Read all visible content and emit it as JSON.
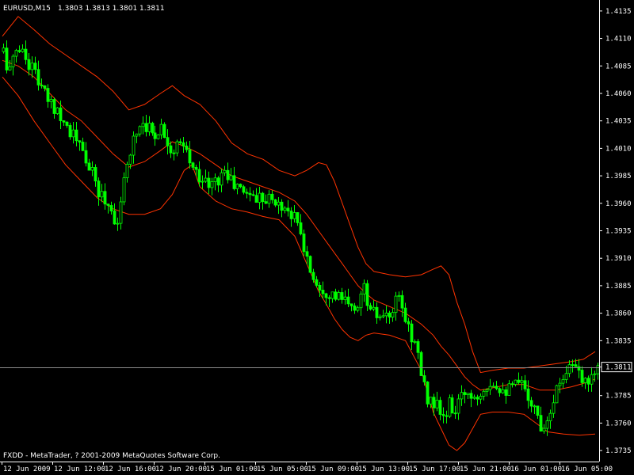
{
  "header": {
    "symbol": "EURUSD,M15",
    "ohlc": "1.3803 1.3813 1.3801 1.3811"
  },
  "footer": {
    "copyright": "FXDD - MetaTrader, ? 2001-2009 MetaQuotes Software Corp."
  },
  "colors": {
    "background": "#000000",
    "candle": "#00ff00",
    "bands": "#ff3300",
    "grid": "#ffffff",
    "priceLine": "#8c8c8c",
    "text": "#ffffff"
  },
  "chart_data": {
    "type": "candlestick",
    "title": "EURUSD,M15",
    "ylim": [
      1.3725,
      1.4145
    ],
    "y_ticks": [
      "1.4135",
      "1.4110",
      "1.4085",
      "1.4060",
      "1.4035",
      "1.4010",
      "1.3985",
      "1.3960",
      "1.3935",
      "1.3910",
      "1.3885",
      "1.3860",
      "1.3835",
      "1.3811",
      "1.3785",
      "1.3760",
      "1.3735"
    ],
    "x_ticks": [
      "12 Jun 2009",
      "12 Jun 12:00",
      "12 Jun 16:00",
      "12 Jun 20:00",
      "15 Jun 01:00",
      "15 Jun 05:00",
      "15 Jun 09:00",
      "15 Jun 13:00",
      "15 Jun 17:00",
      "15 Jun 21:00",
      "16 Jun 01:00",
      "16 Jun 05:00"
    ],
    "current_price": "1.3811",
    "trend": [
      [
        0,
        1.4098
      ],
      [
        5,
        1.4085
      ],
      [
        10,
        1.408
      ],
      [
        15,
        1.41
      ],
      [
        20,
        1.4102
      ],
      [
        30,
        1.409
      ],
      [
        40,
        1.408
      ],
      [
        50,
        1.406
      ],
      [
        60,
        1.405
      ],
      [
        70,
        1.4045
      ],
      [
        80,
        1.403
      ],
      [
        90,
        1.402
      ],
      [
        100,
        1.4005
      ],
      [
        110,
        1.399
      ],
      [
        120,
        1.397
      ],
      [
        130,
        1.3962
      ],
      [
        140,
        1.3948
      ],
      [
        145,
        1.3942
      ],
      [
        150,
        1.3965
      ],
      [
        155,
        1.3995
      ],
      [
        160,
        1.401
      ],
      [
        165,
        1.402
      ],
      [
        170,
        1.403
      ],
      [
        175,
        1.4035
      ],
      [
        180,
        1.4032
      ],
      [
        190,
        1.4022
      ],
      [
        200,
        1.403
      ],
      [
        210,
        1.4015
      ],
      [
        215,
        1.4005
      ],
      [
        220,
        1.4012
      ],
      [
        225,
        1.401
      ],
      [
        230,
        1.401
      ],
      [
        235,
        1.4
      ],
      [
        240,
        1.399
      ],
      [
        250,
        1.3985
      ],
      [
        260,
        1.3975
      ],
      [
        270,
        1.398
      ],
      [
        280,
        1.399
      ],
      [
        290,
        1.3978
      ],
      [
        300,
        1.3972
      ],
      [
        310,
        1.397
      ],
      [
        320,
        1.3965
      ],
      [
        330,
        1.3968
      ],
      [
        340,
        1.3962
      ],
      [
        350,
        1.3958
      ],
      [
        360,
        1.3955
      ],
      [
        370,
        1.3945
      ],
      [
        380,
        1.392
      ],
      [
        390,
        1.3895
      ],
      [
        400,
        1.3885
      ],
      [
        410,
        1.388
      ],
      [
        420,
        1.3875
      ],
      [
        430,
        1.3872
      ],
      [
        440,
        1.3862
      ],
      [
        450,
        1.387
      ],
      [
        455,
        1.3885
      ],
      [
        460,
        1.3872
      ],
      [
        465,
        1.3858
      ],
      [
        470,
        1.386
      ],
      [
        480,
        1.3852
      ],
      [
        490,
        1.3858
      ],
      [
        495,
        1.3868
      ],
      [
        500,
        1.3872
      ],
      [
        505,
        1.3862
      ],
      [
        510,
        1.385
      ],
      [
        515,
        1.3842
      ],
      [
        520,
        1.3832
      ],
      [
        525,
        1.382
      ],
      [
        530,
        1.3795
      ],
      [
        535,
        1.3785
      ],
      [
        540,
        1.378
      ],
      [
        545,
        1.3778
      ],
      [
        550,
        1.3772
      ],
      [
        555,
        1.3765
      ],
      [
        560,
        1.3768
      ],
      [
        565,
        1.3778
      ],
      [
        570,
        1.377
      ],
      [
        575,
        1.3775
      ],
      [
        580,
        1.3782
      ],
      [
        585,
        1.379
      ],
      [
        590,
        1.3788
      ],
      [
        595,
        1.3784
      ],
      [
        600,
        1.3786
      ],
      [
        605,
        1.3792
      ],
      [
        610,
        1.3796
      ],
      [
        620,
        1.3798
      ],
      [
        630,
        1.3793
      ],
      [
        640,
        1.379
      ],
      [
        650,
        1.3795
      ],
      [
        660,
        1.3793
      ],
      [
        665,
        1.3785
      ],
      [
        670,
        1.3775
      ],
      [
        675,
        1.3768
      ],
      [
        680,
        1.3758
      ],
      [
        685,
        1.376
      ],
      [
        690,
        1.377
      ],
      [
        695,
        1.3782
      ],
      [
        700,
        1.379
      ],
      [
        705,
        1.38
      ],
      [
        710,
        1.3808
      ],
      [
        715,
        1.3812
      ],
      [
        720,
        1.3814
      ],
      [
        725,
        1.3805
      ],
      [
        730,
        1.38
      ],
      [
        735,
        1.3795
      ],
      [
        740,
        1.3802
      ],
      [
        745,
        1.3808
      ],
      [
        750,
        1.381
      ],
      [
        752,
        1.3811
      ]
    ],
    "upper_band": [
      [
        0,
        1.4112
      ],
      [
        20,
        1.413
      ],
      [
        40,
        1.4118
      ],
      [
        60,
        1.4105
      ],
      [
        80,
        1.4095
      ],
      [
        100,
        1.4085
      ],
      [
        120,
        1.4075
      ],
      [
        140,
        1.4062
      ],
      [
        160,
        1.4045
      ],
      [
        180,
        1.405
      ],
      [
        200,
        1.406
      ],
      [
        215,
        1.4067
      ],
      [
        230,
        1.4058
      ],
      [
        250,
        1.405
      ],
      [
        270,
        1.4035
      ],
      [
        290,
        1.4015
      ],
      [
        310,
        1.4005
      ],
      [
        330,
        1.4
      ],
      [
        350,
        1.399
      ],
      [
        370,
        1.3985
      ],
      [
        385,
        1.399
      ],
      [
        400,
        1.3997
      ],
      [
        410,
        1.3995
      ],
      [
        420,
        1.398
      ],
      [
        430,
        1.396
      ],
      [
        440,
        1.394
      ],
      [
        450,
        1.392
      ],
      [
        460,
        1.3905
      ],
      [
        470,
        1.3898
      ],
      [
        490,
        1.3895
      ],
      [
        510,
        1.3893
      ],
      [
        530,
        1.3895
      ],
      [
        545,
        1.39
      ],
      [
        555,
        1.3903
      ],
      [
        565,
        1.3895
      ],
      [
        575,
        1.387
      ],
      [
        585,
        1.385
      ],
      [
        595,
        1.3825
      ],
      [
        605,
        1.3806
      ],
      [
        620,
        1.3808
      ],
      [
        640,
        1.381
      ],
      [
        660,
        1.381
      ],
      [
        680,
        1.3812
      ],
      [
        700,
        1.3814
      ],
      [
        720,
        1.3816
      ],
      [
        735,
        1.3818
      ],
      [
        750,
        1.3825
      ]
    ],
    "middle_band": [
      [
        0,
        1.409
      ],
      [
        20,
        1.4085
      ],
      [
        40,
        1.4075
      ],
      [
        60,
        1.406
      ],
      [
        80,
        1.4045
      ],
      [
        100,
        1.4035
      ],
      [
        120,
        1.402
      ],
      [
        140,
        1.4005
      ],
      [
        160,
        1.3993
      ],
      [
        180,
        1.3998
      ],
      [
        200,
        1.4008
      ],
      [
        215,
        1.4016
      ],
      [
        230,
        1.4012
      ],
      [
        250,
        1.4005
      ],
      [
        270,
        1.3995
      ],
      [
        290,
        1.3985
      ],
      [
        310,
        1.398
      ],
      [
        330,
        1.3975
      ],
      [
        350,
        1.397
      ],
      [
        370,
        1.3962
      ],
      [
        385,
        1.395
      ],
      [
        400,
        1.3935
      ],
      [
        410,
        1.3925
      ],
      [
        420,
        1.3915
      ],
      [
        430,
        1.3905
      ],
      [
        440,
        1.3895
      ],
      [
        450,
        1.3885
      ],
      [
        460,
        1.3878
      ],
      [
        470,
        1.3872
      ],
      [
        490,
        1.3866
      ],
      [
        510,
        1.386
      ],
      [
        530,
        1.385
      ],
      [
        545,
        1.384
      ],
      [
        555,
        1.383
      ],
      [
        565,
        1.3822
      ],
      [
        575,
        1.3812
      ],
      [
        585,
        1.3802
      ],
      [
        595,
        1.3795
      ],
      [
        605,
        1.379
      ],
      [
        620,
        1.3792
      ],
      [
        640,
        1.3795
      ],
      [
        660,
        1.3795
      ],
      [
        680,
        1.379
      ],
      [
        700,
        1.379
      ],
      [
        720,
        1.3793
      ],
      [
        735,
        1.3796
      ],
      [
        750,
        1.38
      ]
    ],
    "lower_band": [
      [
        0,
        1.4075
      ],
      [
        20,
        1.4058
      ],
      [
        40,
        1.4035
      ],
      [
        60,
        1.4015
      ],
      [
        80,
        1.3995
      ],
      [
        100,
        1.398
      ],
      [
        120,
        1.3965
      ],
      [
        140,
        1.3955
      ],
      [
        160,
        1.395
      ],
      [
        180,
        1.395
      ],
      [
        200,
        1.3955
      ],
      [
        215,
        1.3968
      ],
      [
        230,
        1.399
      ],
      [
        240,
        1.3995
      ],
      [
        250,
        1.3975
      ],
      [
        270,
        1.3962
      ],
      [
        290,
        1.3955
      ],
      [
        310,
        1.3952
      ],
      [
        330,
        1.3948
      ],
      [
        350,
        1.3945
      ],
      [
        370,
        1.393
      ],
      [
        385,
        1.3905
      ],
      [
        400,
        1.388
      ],
      [
        410,
        1.3868
      ],
      [
        420,
        1.3855
      ],
      [
        430,
        1.3845
      ],
      [
        440,
        1.3838
      ],
      [
        450,
        1.3835
      ],
      [
        460,
        1.384
      ],
      [
        470,
        1.3842
      ],
      [
        490,
        1.384
      ],
      [
        510,
        1.3835
      ],
      [
        530,
        1.3808
      ],
      [
        545,
        1.377
      ],
      [
        555,
        1.3755
      ],
      [
        565,
        1.374
      ],
      [
        575,
        1.3735
      ],
      [
        585,
        1.3742
      ],
      [
        595,
        1.3755
      ],
      [
        605,
        1.3768
      ],
      [
        620,
        1.377
      ],
      [
        640,
        1.377
      ],
      [
        660,
        1.3768
      ],
      [
        675,
        1.376
      ],
      [
        690,
        1.3752
      ],
      [
        710,
        1.375
      ],
      [
        730,
        1.3749
      ],
      [
        750,
        1.375
      ]
    ]
  }
}
